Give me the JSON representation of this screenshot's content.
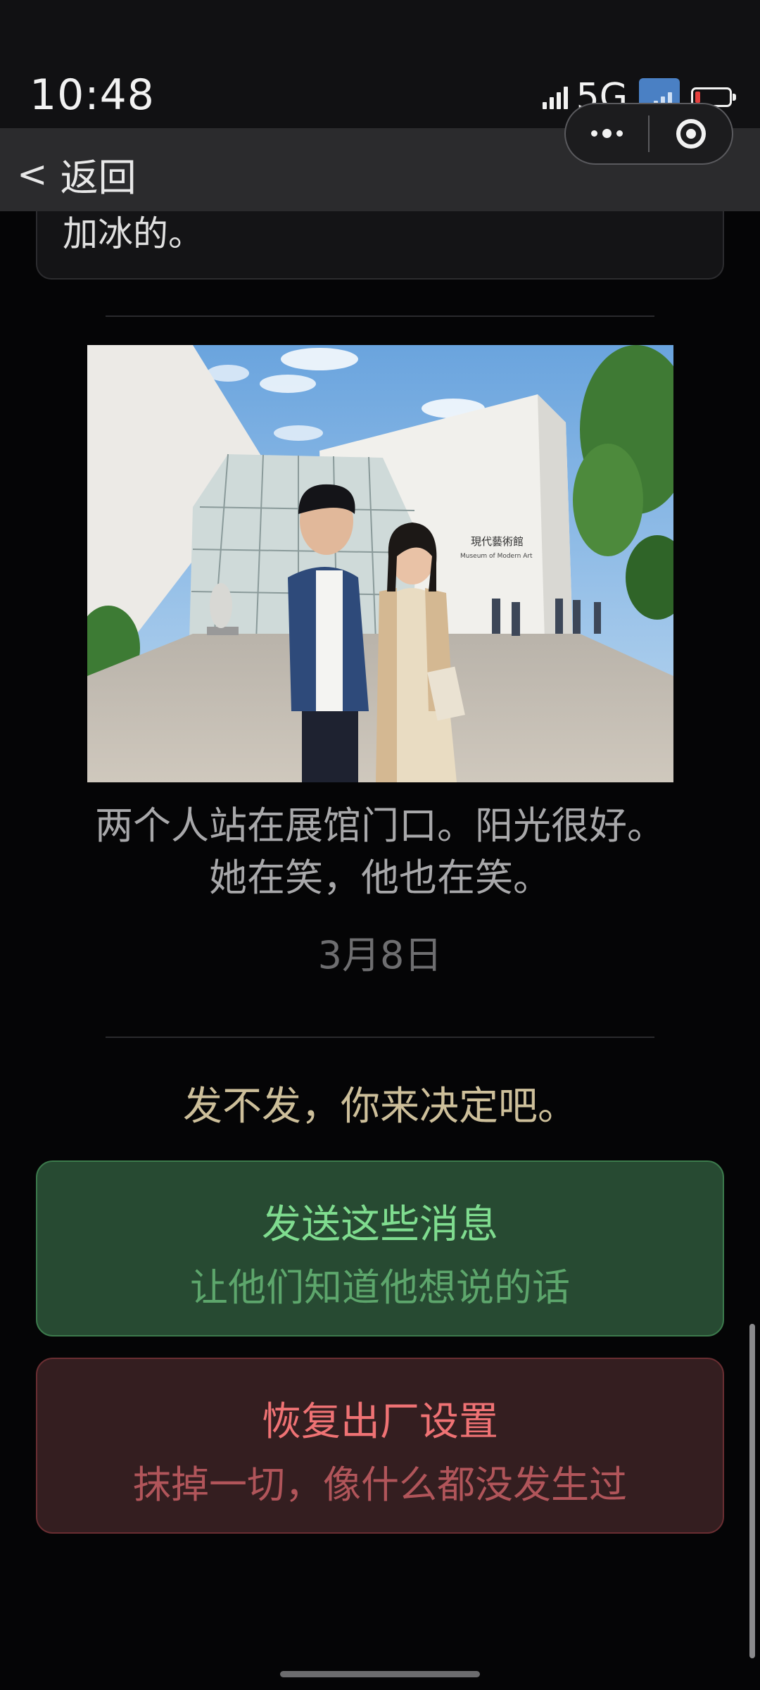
{
  "status_bar": {
    "time": "10:48",
    "network": "5G",
    "icons": [
      "cellular-signal-icon",
      "wifi-icon",
      "battery-icon"
    ],
    "battery_level": 0.15
  },
  "nav": {
    "back_chevron": "<",
    "back_label": "返回",
    "capsule_icons": [
      "more-dots-icon",
      "close-target-icon"
    ]
  },
  "message": {
    "text": "加冰的。"
  },
  "photo": {
    "sign_text_cn": "現代藝術館",
    "sign_text_en": "Museum of Modern Art"
  },
  "caption": {
    "line1": "两个人站在展馆门口。阳光很好。",
    "line2": "她在笑，他也在笑。"
  },
  "date": "3月8日",
  "prompt": "发不发，你来决定吧。",
  "choices": {
    "send": {
      "title": "发送这些消息",
      "subtitle": "让他们知道他想说的话"
    },
    "reset": {
      "title": "恢复出厂设置",
      "subtitle": "抹掉一切，像什么都没发生过"
    }
  },
  "colors": {
    "background": "#050506",
    "send_bg": "#274a32",
    "send_accent": "#7fdc8f",
    "reset_bg": "#341e20",
    "reset_accent": "#ef7274",
    "prompt": "#cdbf9a"
  }
}
